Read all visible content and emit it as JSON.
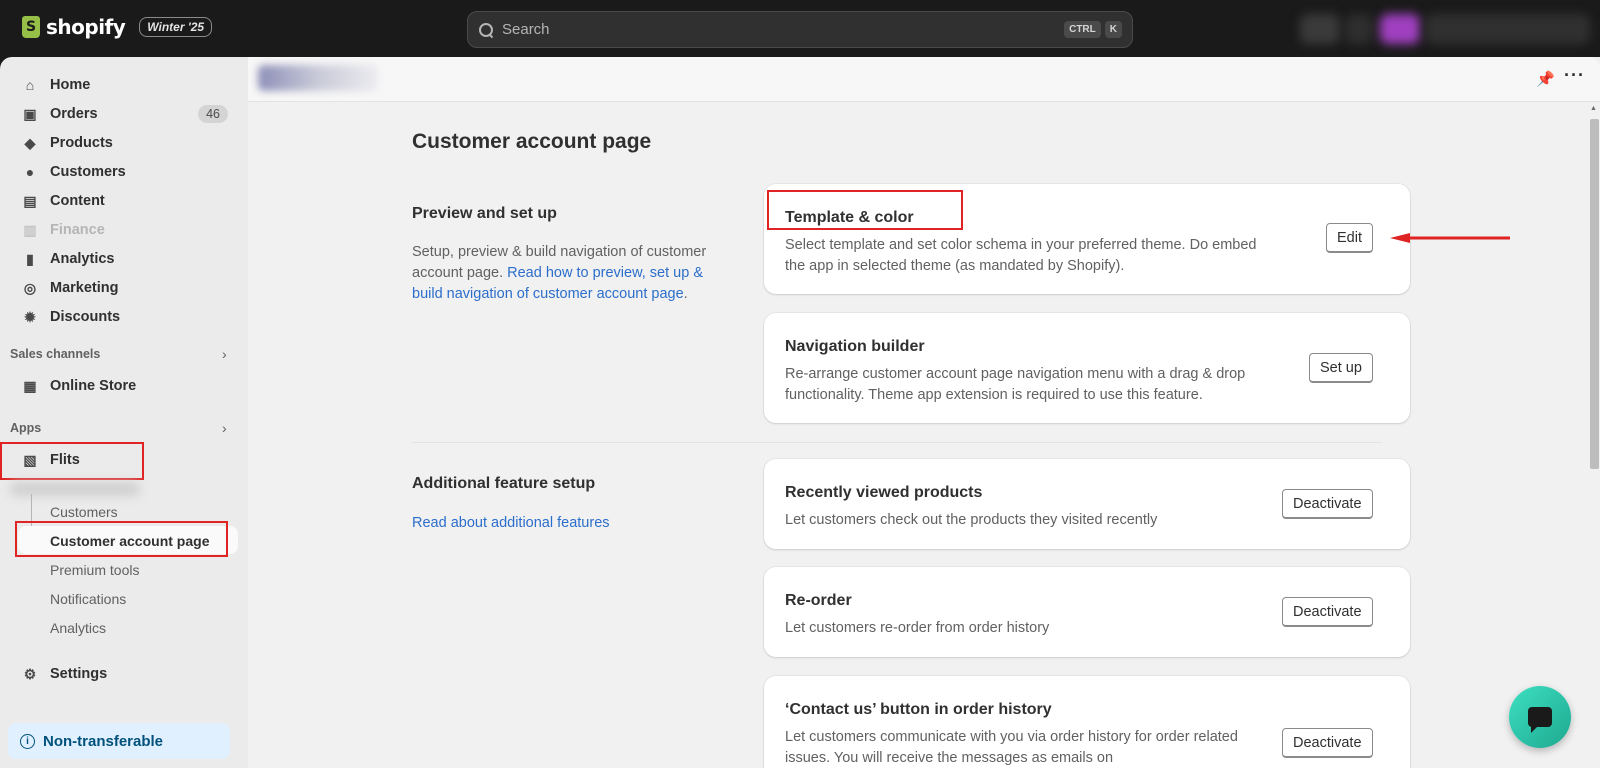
{
  "topbar": {
    "brand": "shopify",
    "edition": "Winter '25",
    "search_placeholder": "Search",
    "shortcut_keys": [
      "CTRL",
      "K"
    ]
  },
  "sidebar": {
    "nav": [
      {
        "label": "Home",
        "icon": "home-icon",
        "disabled": false
      },
      {
        "label": "Orders",
        "icon": "orders-icon",
        "badge": "46",
        "disabled": false
      },
      {
        "label": "Products",
        "icon": "tag-icon",
        "disabled": false
      },
      {
        "label": "Customers",
        "icon": "person-icon",
        "disabled": false
      },
      {
        "label": "Content",
        "icon": "image-icon",
        "disabled": false
      },
      {
        "label": "Finance",
        "icon": "bank-icon",
        "disabled": true
      },
      {
        "label": "Analytics",
        "icon": "bar-chart-icon",
        "disabled": false
      },
      {
        "label": "Marketing",
        "icon": "target-icon",
        "disabled": false
      },
      {
        "label": "Discounts",
        "icon": "discount-icon",
        "disabled": false
      }
    ],
    "sales_channels_label": "Sales channels",
    "online_store_label": "Online Store",
    "apps_label": "Apps",
    "app_name": "Flits",
    "app_subitems": [
      "Customers",
      "Customer account page",
      "Premium tools",
      "Notifications",
      "Analytics"
    ],
    "active_subitem": "Customer account page",
    "settings_label": "Settings",
    "non_transferable_label": "Non-transferable"
  },
  "main": {
    "page_title": "Customer account page",
    "section1": {
      "title": "Preview and set up",
      "desc_plain": "Setup, preview & build navigation of customer account page. ",
      "desc_link": "Read how to preview, set up & build navigation of customer account page",
      "desc_end": "."
    },
    "section2": {
      "title": "Additional feature setup",
      "link": "Read about additional features"
    },
    "cards": [
      {
        "title": "Template & color",
        "desc": "Select template and set color schema in your preferred theme. Do embed the app in selected theme (as mandated by Shopify).",
        "button": "Edit"
      },
      {
        "title": "Navigation builder",
        "desc": "Re-arrange customer account page navigation menu with a drag & drop functionality. Theme app extension is required to use this feature.",
        "button": "Set up"
      },
      {
        "title": "Recently viewed products",
        "desc": "Let customers check out the products they visited recently",
        "button": "Deactivate"
      },
      {
        "title": "Re-order",
        "desc": "Let customers re-order from order history",
        "button": "Deactivate"
      },
      {
        "title": "‘Contact us’ button in order history",
        "desc": "Let customers communicate with you via order history for order related issues. You will receive the messages as emails on",
        "button": "Deactivate"
      }
    ]
  },
  "colors": {
    "accent_link": "#2c6ecb",
    "annotation_red": "#e02424",
    "brand_green": "#95bf47",
    "chat_teal": "#2dc9ab"
  }
}
